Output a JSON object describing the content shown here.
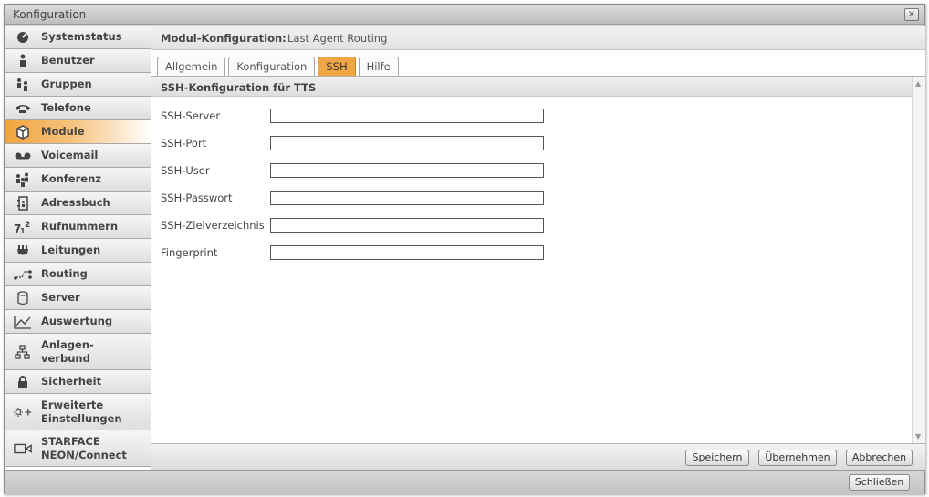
{
  "window": {
    "title": "Konfiguration",
    "close_symbol": "×"
  },
  "sidebar": {
    "items": [
      {
        "label": "Systemstatus",
        "icon": "gauge-icon"
      },
      {
        "label": "Benutzer",
        "icon": "user-icon"
      },
      {
        "label": "Gruppen",
        "icon": "group-icon"
      },
      {
        "label": "Telefone",
        "icon": "phone-icon"
      },
      {
        "label": "Module",
        "icon": "module-icon",
        "active": true
      },
      {
        "label": "Voicemail",
        "icon": "voicemail-icon"
      },
      {
        "label": "Konferenz",
        "icon": "conference-icon"
      },
      {
        "label": "Adressbuch",
        "icon": "addressbook-icon"
      },
      {
        "label": "Rufnummern",
        "icon": "numbers-icon"
      },
      {
        "label": "Leitungen",
        "icon": "plug-icon"
      },
      {
        "label": "Routing",
        "icon": "routing-icon"
      },
      {
        "label": "Server",
        "icon": "server-icon"
      },
      {
        "label": "Auswertung",
        "icon": "chart-icon"
      },
      {
        "label": "Anlagen-",
        "label2": "verbund",
        "icon": "network-icon"
      },
      {
        "label": "Sicherheit",
        "icon": "lock-icon"
      },
      {
        "label": "Erweiterte",
        "label2": "Einstellungen",
        "icon": "advanced-settings-icon"
      },
      {
        "label": "STARFACE",
        "label2": "NEON/Connect",
        "icon": "video-icon"
      }
    ]
  },
  "main": {
    "header_label": "Modul-Konfiguration:",
    "header_value": "Last Agent Routing",
    "tabs": [
      {
        "label": "Allgemein"
      },
      {
        "label": "Konfiguration"
      },
      {
        "label": "SSH",
        "active": true
      },
      {
        "label": "Hilfe"
      }
    ],
    "section_title": "SSH-Konfiguration für TTS",
    "fields": [
      {
        "label": "SSH-Server",
        "value": ""
      },
      {
        "label": "SSH-Port",
        "value": ""
      },
      {
        "label": "SSH-User",
        "value": ""
      },
      {
        "label": "SSH-Passwort",
        "value": ""
      },
      {
        "label": "SSH-Zielverzeichnis",
        "value": ""
      },
      {
        "label": "Fingerprint",
        "value": ""
      }
    ],
    "buttons": {
      "save": "Speichern",
      "apply": "Übernehmen",
      "cancel": "Abbrechen"
    }
  },
  "bottom": {
    "close": "Schließen"
  },
  "colors": {
    "accent": "#f0a645"
  }
}
